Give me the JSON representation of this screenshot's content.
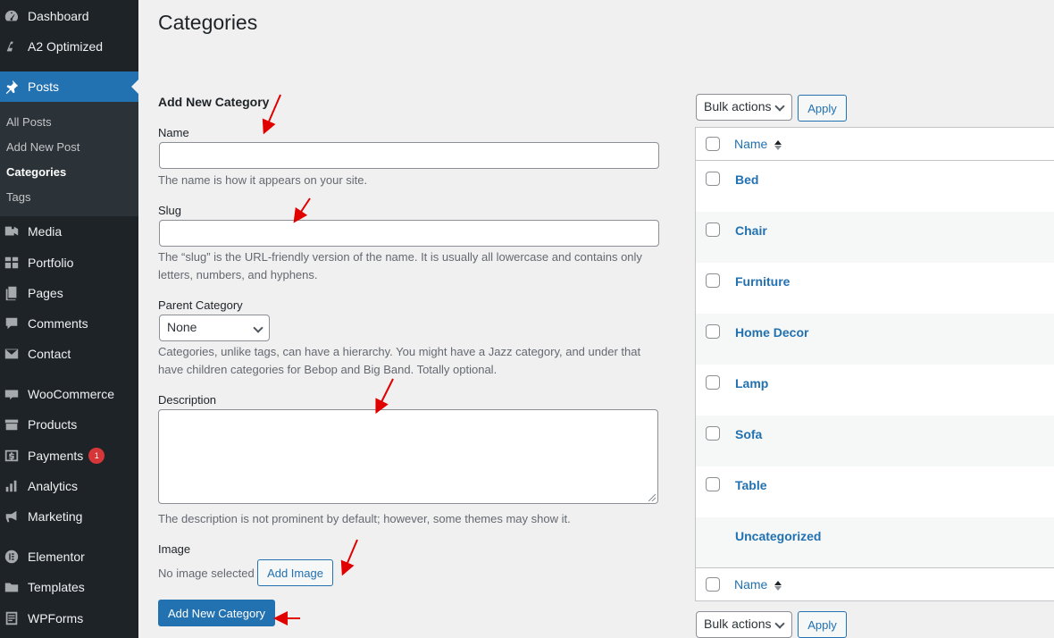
{
  "sidebar": {
    "items": [
      {
        "label": "Dashboard",
        "icon": "dashboard-icon"
      },
      {
        "label": "A2 Optimized",
        "icon": "a2-icon"
      },
      {
        "label": "Posts",
        "icon": "pin-icon",
        "active": true
      },
      {
        "label": "Media",
        "icon": "media-icon"
      },
      {
        "label": "Portfolio",
        "icon": "portfolio-icon"
      },
      {
        "label": "Pages",
        "icon": "pages-icon"
      },
      {
        "label": "Comments",
        "icon": "comments-icon"
      },
      {
        "label": "Contact",
        "icon": "mail-icon"
      },
      {
        "label": "WooCommerce",
        "icon": "woo-icon"
      },
      {
        "label": "Products",
        "icon": "products-icon"
      },
      {
        "label": "Payments",
        "icon": "payments-icon",
        "badge": "1"
      },
      {
        "label": "Analytics",
        "icon": "analytics-icon"
      },
      {
        "label": "Marketing",
        "icon": "megaphone-icon"
      },
      {
        "label": "Elementor",
        "icon": "elementor-icon"
      },
      {
        "label": "Templates",
        "icon": "folder-icon"
      },
      {
        "label": "WPForms",
        "icon": "wpforms-icon"
      }
    ],
    "submenu": [
      "All Posts",
      "Add New Post",
      "Categories",
      "Tags"
    ]
  },
  "page": {
    "title": "Categories"
  },
  "form": {
    "heading": "Add New Category",
    "name_label": "Name",
    "name_help": "The name is how it appears on your site.",
    "slug_label": "Slug",
    "slug_help": "The “slug” is the URL-friendly version of the name. It is usually all lowercase and contains only letters, numbers, and hyphens.",
    "parent_label": "Parent Category",
    "parent_value": "None",
    "parent_help": "Categories, unlike tags, can have a hierarchy. You might have a Jazz category, and under that have children categories for Bebop and Big Band. Totally optional.",
    "description_label": "Description",
    "description_help": "The description is not prominent by default; however, some themes may show it.",
    "image_label": "Image",
    "no_image_text": "No image selected",
    "add_image_button": "Add Image",
    "submit_button": "Add New Category"
  },
  "list": {
    "bulk_actions": "Bulk actions",
    "apply": "Apply",
    "column_name": "Name",
    "rows": [
      "Bed",
      "Chair",
      "Furniture",
      "Home Decor",
      "Lamp",
      "Sofa",
      "Table",
      "Uncategorized"
    ]
  },
  "colors": {
    "accent": "#2271b1",
    "sidebar": "#1d2327",
    "annotation_arrow": "#e00000"
  }
}
